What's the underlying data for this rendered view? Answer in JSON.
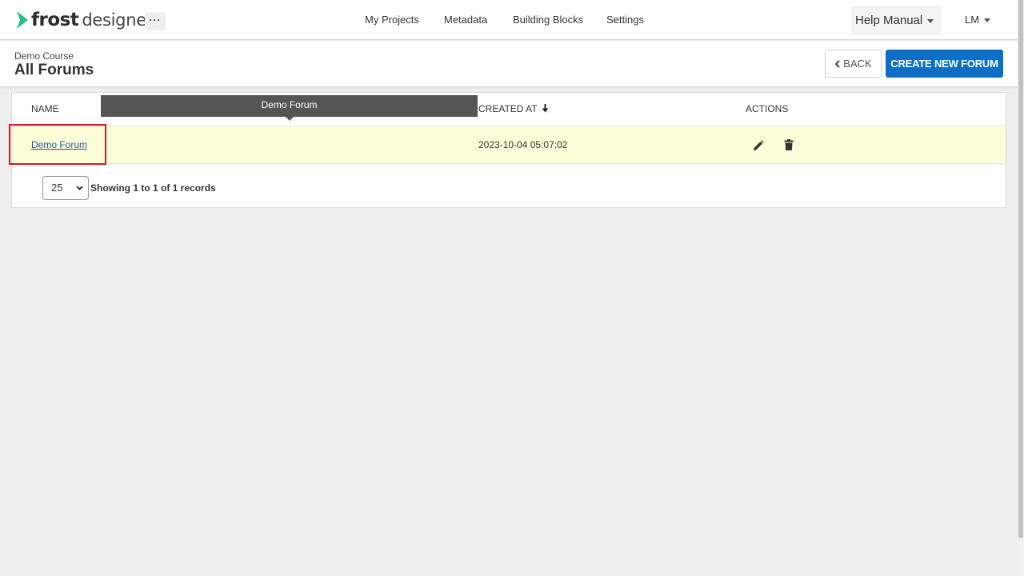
{
  "app": {
    "logo_frost": "frost",
    "logo_designer": "designer",
    "more_label": "···"
  },
  "nav": {
    "items": [
      "My Projects",
      "Metadata",
      "Building Blocks",
      "Settings"
    ],
    "help_label": "Help Manual",
    "user_label": "LM"
  },
  "header": {
    "course": "Demo Course",
    "title": "All Forums",
    "back_label": "BACK",
    "create_label": "CREATE NEW FORUM"
  },
  "table": {
    "columns": {
      "name": "NAME",
      "created_at": "CREATED AT",
      "actions": "ACTIONS"
    },
    "rows": [
      {
        "name": "Demo Forum",
        "created_at": "2023-10-04 05:07:02"
      }
    ]
  },
  "tooltip": {
    "text": "Demo Forum"
  },
  "pagination": {
    "page_size": "25",
    "summary": "Showing 1 to 1 of 1 records"
  },
  "colors": {
    "accent": "#0b6fc7",
    "logo_green": "#26c281",
    "highlight_row": "#fcfdd9",
    "focus_outline": "#d81b1b"
  }
}
